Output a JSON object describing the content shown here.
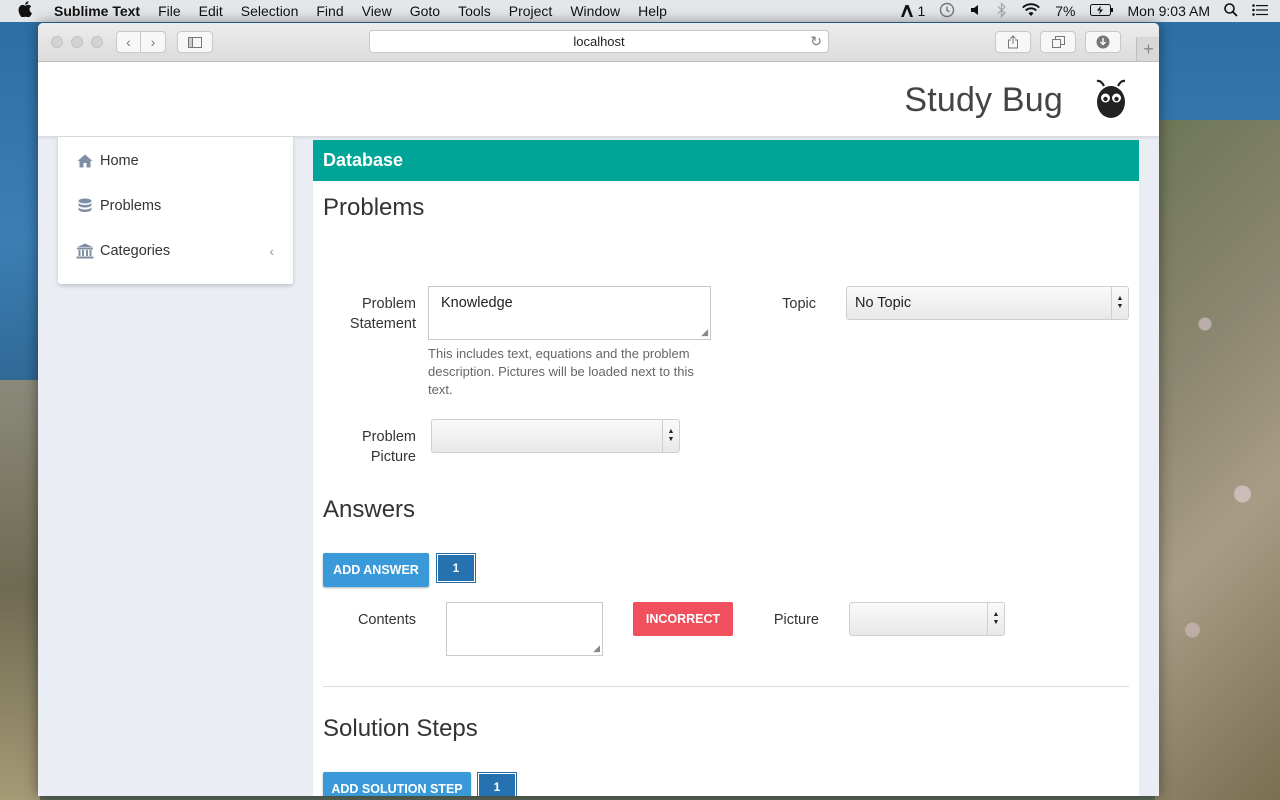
{
  "menubar": {
    "app_name": "Sublime Text",
    "menus": [
      "File",
      "Edit",
      "Selection",
      "Find",
      "View",
      "Goto",
      "Tools",
      "Project",
      "Window",
      "Help"
    ],
    "status": {
      "adobe_badge": "1",
      "battery": "7%",
      "clock": "Mon 9:03 AM"
    }
  },
  "browser": {
    "url": "localhost"
  },
  "app": {
    "brand": "Study Bug"
  },
  "sidebar": {
    "items": [
      {
        "label": "Home",
        "icon": "home-icon"
      },
      {
        "label": "Problems",
        "icon": "database-icon"
      },
      {
        "label": "Categories",
        "icon": "bank-icon"
      }
    ]
  },
  "panel": {
    "header": "Database",
    "title": "Problems",
    "form": {
      "problem_statement_label": "Problem Statement",
      "problem_statement_value": "Knowledge",
      "problem_statement_help": "This includes text, equations and the problem description. Pictures will be loaded next to this text.",
      "topic_label": "Topic",
      "topic_value": "No Topic",
      "problem_picture_label": "Problem Picture",
      "problem_picture_value": ""
    },
    "answers": {
      "title": "Answers",
      "add_label": "ADD ANSWER",
      "count": "1",
      "contents_label": "Contents",
      "contents_value": "",
      "status_label": "INCORRECT",
      "picture_label": "Picture",
      "picture_value": ""
    },
    "solution_steps": {
      "title": "Solution Steps",
      "add_label": "ADD SOLUTION STEP",
      "count": "1"
    }
  },
  "colors": {
    "accent_teal": "#00a598",
    "button_blue": "#3a9ad9",
    "counter_blue": "#2672b0",
    "incorrect_red": "#f0505e"
  }
}
